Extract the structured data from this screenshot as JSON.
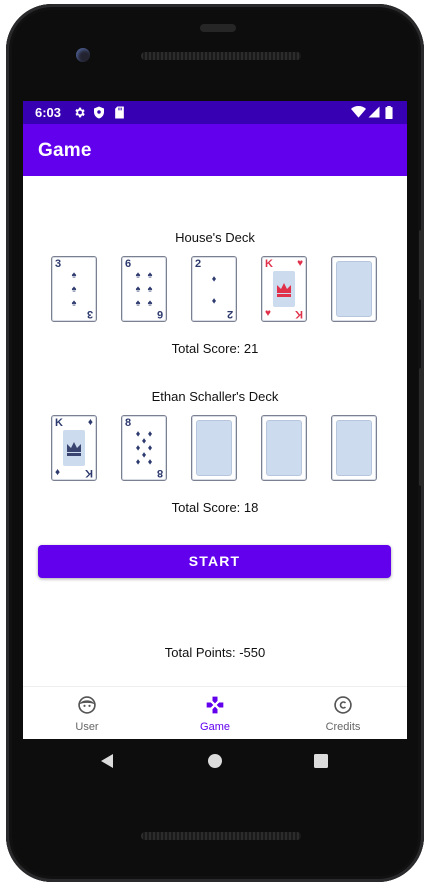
{
  "status_bar": {
    "time": "6:03"
  },
  "app_bar": {
    "title": "Game"
  },
  "house": {
    "label": "House's Deck",
    "score_label": "Total Score:  21",
    "cards": [
      {
        "rank": "3",
        "suit": "spade",
        "color": "#2d3a6e"
      },
      {
        "rank": "6",
        "suit": "spade",
        "color": "#2d3a6e"
      },
      {
        "rank": "2",
        "suit": "diamond",
        "color": "#2d3a6e"
      },
      {
        "rank": "K",
        "suit": "heart",
        "color": "#e0304a"
      },
      {
        "rank": "",
        "suit": "back"
      }
    ]
  },
  "player": {
    "label": "Ethan Schaller's Deck",
    "score_label": "Total Score:  18",
    "cards": [
      {
        "rank": "K",
        "suit": "diamond",
        "color": "#2d3a6e"
      },
      {
        "rank": "8",
        "suit": "diamond",
        "color": "#2d3a6e"
      },
      {
        "rank": "",
        "suit": "back"
      },
      {
        "rank": "",
        "suit": "back"
      },
      {
        "rank": "",
        "suit": "back"
      }
    ]
  },
  "start_button": {
    "label": "START"
  },
  "points_label": "Total Points: -550",
  "bottom_nav": {
    "items": [
      {
        "label": "User",
        "icon": "face-icon"
      },
      {
        "label": "Game",
        "icon": "gamepad-icon",
        "active": true
      },
      {
        "label": "Credits",
        "icon": "copyright-icon"
      }
    ]
  },
  "colors": {
    "primary": "#6200ee",
    "primary_dark": "#3700b3",
    "card_back": "#cddbee"
  }
}
